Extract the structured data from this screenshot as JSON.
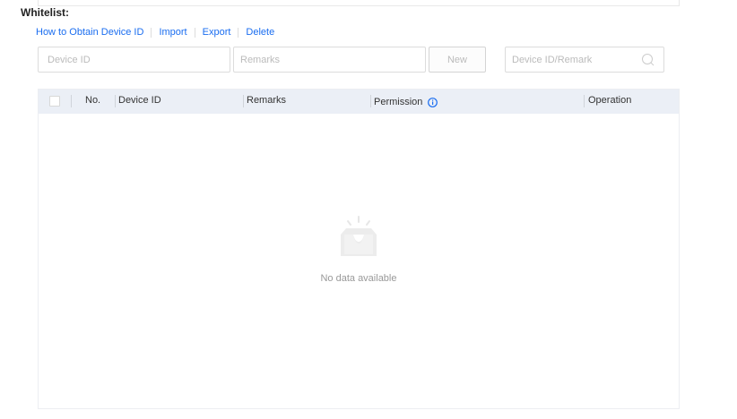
{
  "title": "Whitelist:",
  "links": [
    "How to Obtain Device ID",
    "Import",
    "Export",
    "Delete"
  ],
  "form": {
    "device_id_placeholder": "Device ID",
    "remarks_placeholder": "Remarks",
    "new_label": "New",
    "search_placeholder": "Device ID/Remark"
  },
  "table": {
    "columns": [
      "No.",
      "Device ID",
      "Remarks",
      "Permission",
      "Operation"
    ],
    "empty_text": "No data available"
  },
  "colors": {
    "link": "#1a6df0",
    "header_bg": "#ebeff6"
  }
}
